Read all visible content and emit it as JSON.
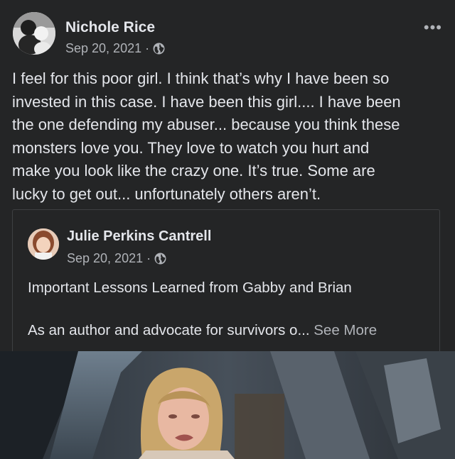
{
  "post": {
    "author": "Nichole Rice",
    "date": "Sep 20, 2021 ·",
    "privacy_icon": "globe-icon",
    "more_label": "•••",
    "text_lines": [
      "I feel for this poor girl. I think that’s why I have been so",
      "invested in this case. I have been this girl.... I have been",
      "the one defending my abuser... because you think these",
      "monsters love you.  They love to watch you hurt and",
      "make you look like the crazy one. It’s true. Some are",
      "lucky to get out... unfortunately others aren’t."
    ]
  },
  "shared": {
    "author": "Julie Perkins Cantrell",
    "date": "Sep 20, 2021 ·",
    "privacy_icon": "globe-icon",
    "title": "Important Lessons Learned from Gabby and Brian",
    "excerpt": "As an author and advocate for survivors o...",
    "see_more": "See More"
  },
  "colors": {
    "background": "#242526",
    "text_primary": "#e4e6eb",
    "text_secondary": "#b0b3b8",
    "card_border": "#3e4042"
  }
}
